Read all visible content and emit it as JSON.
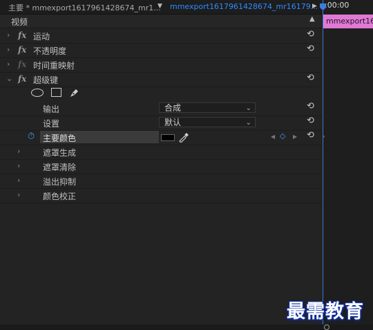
{
  "tabs": {
    "source_label": "主要 * mmexport1617961428674_mr1...",
    "sequence_label": "mmexport1617961428674_mr16179...",
    "timecode": ":00:00"
  },
  "section": {
    "title": "视频"
  },
  "effects": [
    {
      "label": "运动",
      "fx_disabled": false
    },
    {
      "label": "不透明度",
      "fx_disabled": false
    },
    {
      "label": "时间重映射",
      "fx_disabled": true
    },
    {
      "label": "超级键",
      "fx_disabled": false
    }
  ],
  "ultra_key": {
    "output_label": "输出",
    "output_value": "合成",
    "setting_label": "设置",
    "setting_value": "默认",
    "key_color_label": "主要颜色",
    "key_color_value": "#000000",
    "groups": [
      "遮罩生成",
      "遮罩清除",
      "溢出抑制",
      "颜色校正"
    ]
  },
  "clip": {
    "name": "mmexport1617961428674"
  },
  "watermark": "最需教育",
  "icons": {
    "expand": "chevron-right-icon",
    "expanded": "chevron-down-icon",
    "reset": "reset-icon",
    "stopwatch": "stopwatch-icon",
    "eyedropper": "eyedropper-icon",
    "ellipse_mask": "ellipse-mask-icon",
    "rect_mask": "rectangle-mask-icon",
    "pen_mask": "pen-mask-icon"
  },
  "colors": {
    "playhead": "#3d7ddb",
    "clip": "#e079d4",
    "active_tab": "#2f8bff",
    "watermark_outline": "#1233a8"
  }
}
